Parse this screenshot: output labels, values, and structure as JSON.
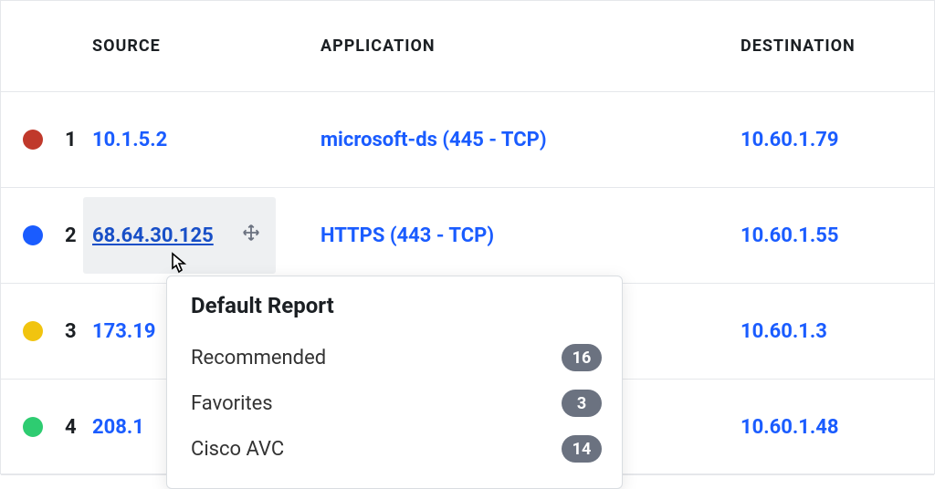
{
  "header": {
    "source": "SOURCE",
    "application": "APPLICATION",
    "destination": "DESTINATION"
  },
  "rows": [
    {
      "idx": "1",
      "color": "#c0392b",
      "source": "10.1.5.2",
      "app": "microsoft-ds (445 - TCP)",
      "dest": "10.60.1.79",
      "hovered": false
    },
    {
      "idx": "2",
      "color": "#1a5cff",
      "source": "68.64.30.125",
      "app": "HTTPS (443 - TCP)",
      "dest": "10.60.1.55",
      "hovered": true
    },
    {
      "idx": "3",
      "color": "#f1c40f",
      "source": "173.19",
      "app": "",
      "dest": "10.60.1.3",
      "hovered": false
    },
    {
      "idx": "4",
      "color": "#2ecc71",
      "source": "208.1",
      "app": "",
      "dest": "10.60.1.48",
      "hovered": false
    }
  ],
  "popover": {
    "title": "Default Report",
    "items": [
      {
        "label": "Recommended",
        "count": "16"
      },
      {
        "label": "Favorites",
        "count": "3"
      },
      {
        "label": "Cisco AVC",
        "count": "14"
      }
    ]
  }
}
